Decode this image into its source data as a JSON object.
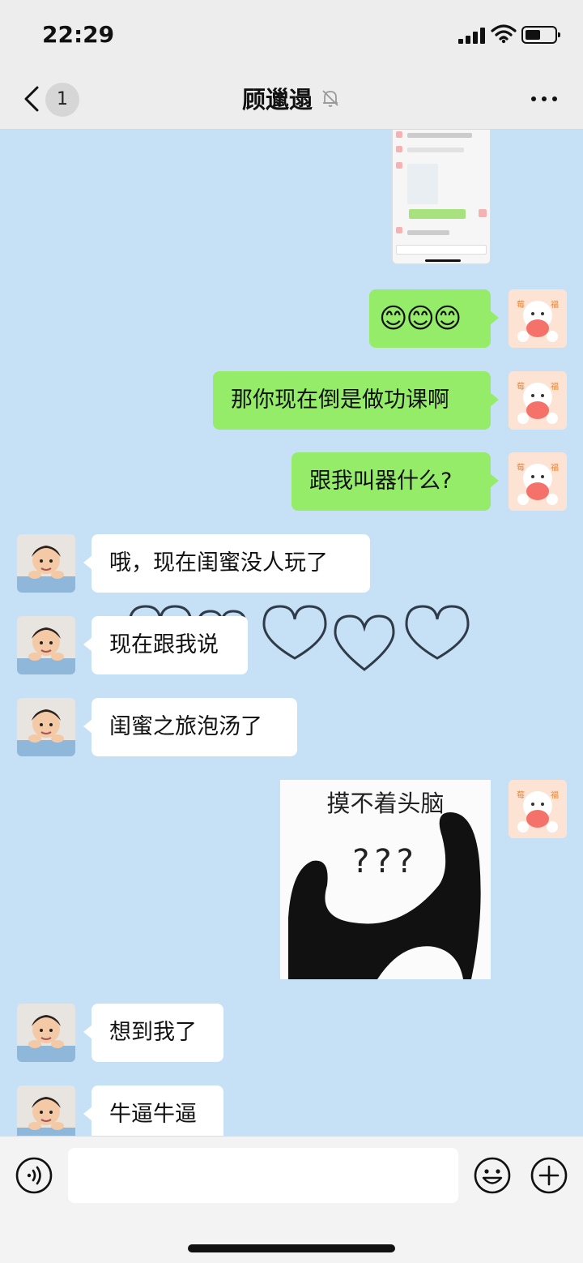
{
  "status_bar": {
    "time": "22:29"
  },
  "header": {
    "back_count": "1",
    "title": "顾邋遢",
    "muted": true
  },
  "messages": [
    {
      "from": "me",
      "type": "image",
      "image": "chat-screenshot"
    },
    {
      "from": "me",
      "type": "emoji",
      "text": "😊😊😊"
    },
    {
      "from": "me",
      "type": "text",
      "text": "那你现在倒是做功课啊"
    },
    {
      "from": "me",
      "type": "text",
      "text": "跟我叫器什么?"
    },
    {
      "from": "them",
      "type": "text",
      "text": "哦，现在闺蜜没人玩了"
    },
    {
      "from": "them",
      "type": "text",
      "text": "现在跟我说"
    },
    {
      "from": "them",
      "type": "text",
      "text": "闺蜜之旅泡汤了"
    },
    {
      "from": "me",
      "type": "sticker",
      "caption": "摸不着头脑",
      "overlay": "???"
    },
    {
      "from": "them",
      "type": "text",
      "text": "想到我了"
    },
    {
      "from": "them",
      "type": "text",
      "text": "牛逼牛逼"
    }
  ],
  "input_bar": {
    "placeholder": "",
    "icons": [
      "voice-icon",
      "emoji-icon",
      "plus-icon"
    ]
  },
  "colors": {
    "background": "#c6e1f6",
    "my_bubble": "#95ec69",
    "their_bubble": "#ffffff",
    "header": "#ededed"
  }
}
